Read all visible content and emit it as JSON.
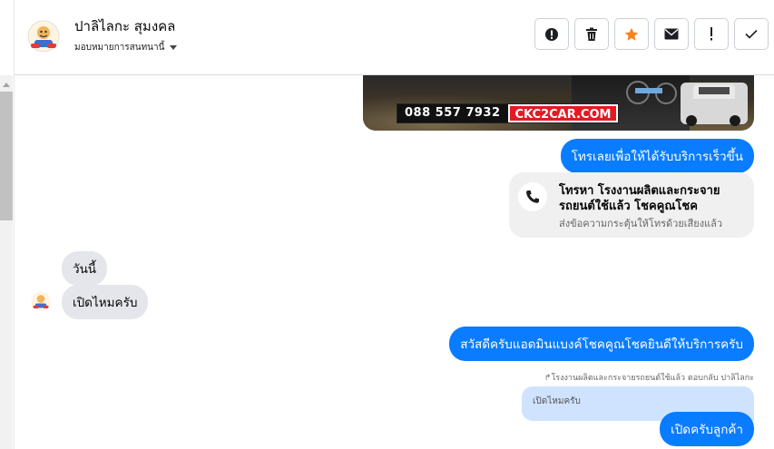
{
  "contact": {
    "name": "ปาลิไลกะ สุมงคล",
    "assign_label": "มอบหมายการสนทนานี้"
  },
  "actions": [
    {
      "name": "spam",
      "icon": "alert-circle-icon"
    },
    {
      "name": "delete",
      "icon": "trash-icon"
    },
    {
      "name": "star",
      "icon": "star-icon",
      "color": "#f5821f"
    },
    {
      "name": "email",
      "icon": "envelope-icon"
    },
    {
      "name": "important",
      "icon": "exclamation-icon"
    },
    {
      "name": "done",
      "icon": "check-icon"
    }
  ],
  "banner": {
    "phone": "088 557 7932",
    "site": "CKC2CAR.COM"
  },
  "messages": {
    "out_cta": "โทรเลยเพื่อให้ได้รับบริการเร็วขึ้น",
    "call_card_title": "โทรหา โรงงานผลิตและกระจายรถยนต์ใช้แล้ว โชคคูณโชค",
    "call_card_sub": "ส่งข้อความกระตุ้นให้โทรด้วยเสียงแล้ว",
    "in_today": "วันนี้",
    "in_open": "เปิดไหมครับ",
    "out_greeting": "สวัสดีครับแอดมินแบงค์โชคคูณโชคยินดีให้บริการครับ",
    "reply_meta": "โรงงานผลิตและกระจายรถยนต์ใช้แล้ว ตอบกลับ ปาลิไลกะ",
    "reply_quote": "เปิดไหมครับ",
    "out_reply": "เปิดครับลูกค้า"
  },
  "colors": {
    "bubble_out": "#0a7cff",
    "bubble_in": "#e4e6eb",
    "reply_quote": "#cfe3ff"
  }
}
